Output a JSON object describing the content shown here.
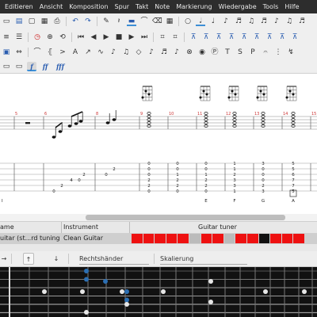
{
  "menu": [
    "Editieren",
    "Ansicht",
    "Komposition",
    "Spur",
    "Takt",
    "Note",
    "Markierung",
    "Wiedergabe",
    "Tools",
    "Hilfe"
  ],
  "toolbar_icons": {
    "row1": [
      "file-new-icon",
      "file-open-icon",
      "save-icon",
      "save-as-icon",
      "print-icon",
      "undo-icon",
      "redo-icon",
      "pencil-icon",
      "rest-icon",
      "note-bar-icon",
      "tie-icon",
      "eraser-icon",
      "whole-note-icon",
      "half-note-icon",
      "quarter-note-icon",
      "eighth-note-icon",
      "sixteenth-note-icon",
      "thirty-second-note-icon",
      "sixty-fourth-note-icon"
    ],
    "row2": [
      "align-left-icon",
      "metronome-icon",
      "count-in-icon",
      "loop-icon",
      "first-icon",
      "rewind-icon",
      "play-icon",
      "stop-icon",
      "forward-icon",
      "last-icon",
      "chord-a-icon",
      "chord-b-icon",
      "chord-c-icon",
      "chord-d-icon",
      "chord-e-icon",
      "chord-f-icon",
      "chord-g-icon"
    ],
    "row3": [
      "mixer-icon",
      "pan-icon",
      "slur-icon",
      "repeat-icon",
      "accent-icon",
      "staccato-icon",
      "bend-icon",
      "vibrato-icon",
      "slide-icon",
      "hammer-icon",
      "harmonic-icon",
      "trill-icon",
      "tremolo-icon",
      "palm-mute-icon",
      "tap-icon",
      "slap-icon",
      "pop-icon",
      "text-icon",
      "arpeggio-icon"
    ],
    "row4": [
      "dynamic-p-icon",
      "dynamic-mf-icon",
      "dynamic-f-icon",
      "dynamic-fff-icon"
    ]
  },
  "dynamics": [
    "f",
    "ff",
    "fff"
  ],
  "score": {
    "measure_numbers": [
      "5",
      "6",
      "7",
      "8",
      "9",
      "10",
      "11",
      "12",
      "13",
      "14",
      "15",
      "16"
    ],
    "tab_frets": {
      "m6": [
        "0",
        "2",
        "4"
      ],
      "m7": [
        "0",
        "2"
      ],
      "m8": [
        "0",
        "2"
      ],
      "m10": [
        "0",
        "0",
        "0",
        "2",
        "2",
        "0"
      ],
      "m11": [
        "0",
        "0",
        "1",
        "2",
        "2",
        "0"
      ],
      "m12": [
        "0",
        "0",
        "1",
        "2",
        "2",
        "0"
      ],
      "m13": [
        "1",
        "1",
        "2",
        "3",
        "3",
        "1"
      ],
      "m14": [
        "3",
        "0",
        "0",
        "0",
        "2",
        "3"
      ],
      "m15": [
        "0",
        "2",
        "2",
        "2",
        "0"
      ],
      "m16": [
        "5",
        "5",
        "6",
        "7",
        "7",
        "5"
      ]
    },
    "chord_names": [
      "E",
      "F",
      "G",
      "A"
    ],
    "first_label": "I"
  },
  "track_panel": {
    "header_name": "ame",
    "header_instrument": "Instrument",
    "header_tuner": "Guitar tuner",
    "track_name": "uitar (st...rd tuning)",
    "instrument": "Clean Guitar"
  },
  "fretboard_toolbar": {
    "left_arrow": "→",
    "up_arrow": "↑",
    "down_arrow": "↓",
    "handedness": "Rechtshänder",
    "scale": "Skalierung"
  },
  "colors": {
    "menubar": "#2d2d2d",
    "tuner_red": "#ee1111",
    "fret_dot_blue": "#2c6fb3",
    "fret_dot_white": "#e6e6e6",
    "measure_number_red": "#cc3333"
  }
}
